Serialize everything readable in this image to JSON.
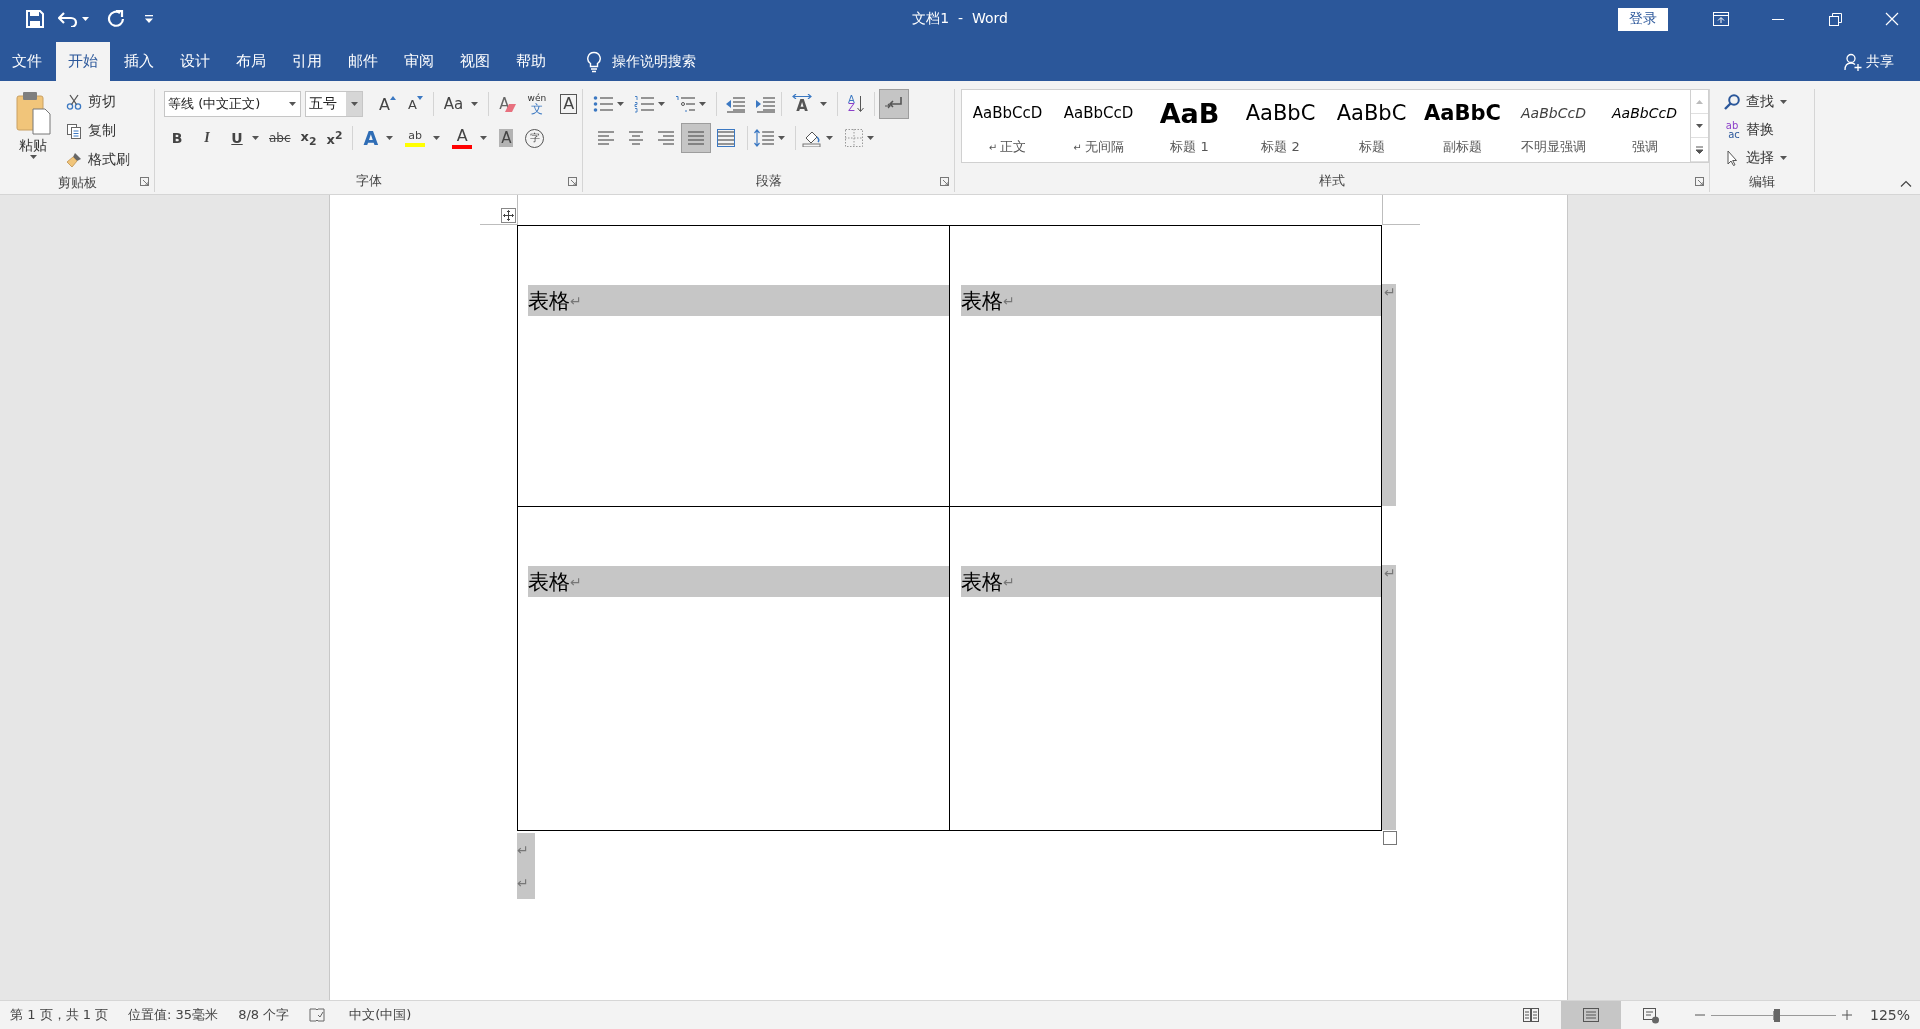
{
  "window": {
    "title": "文档1  -  Word",
    "sign_in": "登录"
  },
  "tabs": [
    {
      "label": "文件",
      "selected": false
    },
    {
      "label": "开始",
      "selected": true
    },
    {
      "label": "插入",
      "selected": false
    },
    {
      "label": "设计",
      "selected": false
    },
    {
      "label": "布局",
      "selected": false
    },
    {
      "label": "引用",
      "selected": false
    },
    {
      "label": "邮件",
      "selected": false
    },
    {
      "label": "审阅",
      "selected": false
    },
    {
      "label": "视图",
      "selected": false
    },
    {
      "label": "帮助",
      "selected": false
    }
  ],
  "tell_me": "操作说明搜索",
  "share": "共享",
  "clipboard": {
    "paste": "粘贴",
    "cut": "剪切",
    "copy": "复制",
    "format_painter": "格式刷",
    "label": "剪贴板"
  },
  "font": {
    "name": "等线 (中文正文)",
    "size": "五号",
    "grow": "A",
    "shrink": "A",
    "change_case": "Aa",
    "clear_formatting": "A",
    "phonetic_top": "wén",
    "phonetic_bottom": "文",
    "border_char": "A",
    "bold": "B",
    "italic": "I",
    "underline": "U",
    "strikethrough": "abc",
    "subscript": "x$_{2}$",
    "superscript": "x$^{2}$",
    "text_effect": "A",
    "highlight": "ab",
    "font_color": "A",
    "shading": "A",
    "enclose": "字",
    "label": "字体"
  },
  "paragraph": {
    "label": "段落",
    "show_marks": true,
    "asian_layout": "A",
    "sort_top": "A",
    "sort_bottom": "Z",
    "alignment": [
      {
        "kind": "left",
        "selected": false
      },
      {
        "kind": "center",
        "selected": false
      },
      {
        "kind": "right",
        "selected": false
      },
      {
        "kind": "justify",
        "selected": true
      },
      {
        "kind": "distributed",
        "selected": false
      }
    ]
  },
  "styles": {
    "label": "样式",
    "items": [
      {
        "kind": "normal",
        "preview": "AaBbCcD",
        "mark": "↵",
        "name": "正文"
      },
      {
        "kind": "no_spacing",
        "preview": "AaBbCcD",
        "mark": "↵",
        "name": "无间隔"
      },
      {
        "kind": "heading1",
        "preview": "AaB",
        "name": "标题 1"
      },
      {
        "kind": "heading2",
        "preview": "AaBbC",
        "name": "标题 2"
      },
      {
        "kind": "title",
        "preview": "AaBbC",
        "name": "标题"
      },
      {
        "kind": "subtitle",
        "preview": "AaBbC",
        "name": "副标题"
      },
      {
        "kind": "subtle_emphasis",
        "preview": "AaBbCcD",
        "name": "不明显强调"
      },
      {
        "kind": "emphasis",
        "preview": "AaBbCcD",
        "name": "强调"
      }
    ]
  },
  "editing": {
    "label": "编辑",
    "find": "查找",
    "replace": "替换",
    "replace_icon_top": "ab",
    "replace_icon_bottom": "ac",
    "select": "选择"
  },
  "document": {
    "rows": [
      {
        "cells": [
          {
            "text": "表格",
            "mark": "↵"
          },
          {
            "text": "表格",
            "mark": "↵"
          }
        ],
        "end_mark": "↵"
      },
      {
        "cells": [
          {
            "text": "表格",
            "mark": "↵"
          },
          {
            "text": "表格",
            "mark": "↵"
          }
        ],
        "end_mark": "↵"
      }
    ],
    "after_table": [
      "↵",
      "↵"
    ]
  },
  "status_bar": {
    "page": "第 1 页，共 1 页",
    "position": "位置值: 35毫米",
    "word_count": "8/8 个字",
    "language": "中文(中国)",
    "views": [
      {
        "kind": "read",
        "selected": false
      },
      {
        "kind": "print",
        "selected": true
      },
      {
        "kind": "web",
        "selected": false
      }
    ],
    "zoom_slider": {
      "level": 0.53
    },
    "zoom": "125%"
  }
}
